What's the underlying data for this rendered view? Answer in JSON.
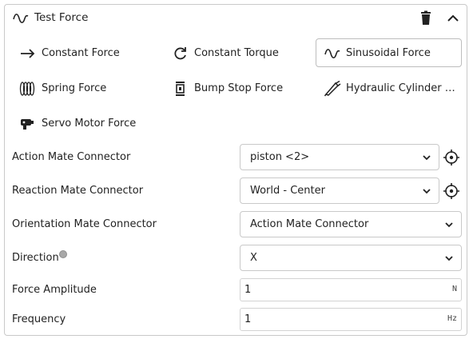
{
  "feature": {
    "title": "Test Force",
    "title_icon": "sine-wave-icon",
    "delete_icon": "trash-icon",
    "collapse_icon": "chevron-up-icon"
  },
  "force_types": [
    {
      "label": "Constant Force",
      "icon": "arrow-right-icon",
      "selected": false
    },
    {
      "label": "Constant Torque",
      "icon": "rotate-arrow-icon",
      "selected": false
    },
    {
      "label": "Sinusoidal Force",
      "icon": "sine-wave-icon",
      "selected": true
    },
    {
      "label": "Spring Force",
      "icon": "spring-coil-icon",
      "selected": false
    },
    {
      "label": "Bump Stop Force",
      "icon": "bump-stop-icon",
      "selected": false
    },
    {
      "label": "Hydraulic Cylinder F...",
      "icon": "hydraulic-cylinder-icon",
      "selected": false
    },
    {
      "label": "Servo Motor Force",
      "icon": "servo-motor-icon",
      "selected": false
    }
  ],
  "fields": {
    "action_mate": {
      "label": "Action Mate Connector",
      "value": "piston <2>"
    },
    "reaction_mate": {
      "label": "Reaction Mate Connector",
      "value": "World - Center"
    },
    "orientation_mate": {
      "label": "Orientation Mate Connector",
      "value": "Action Mate Connector"
    },
    "direction": {
      "label": "Direction",
      "value": "X"
    },
    "force_amplitude": {
      "label": "Force Amplitude",
      "value": "1",
      "unit": "N"
    },
    "frequency": {
      "label": "Frequency",
      "value": "1",
      "unit": "Hz"
    }
  }
}
